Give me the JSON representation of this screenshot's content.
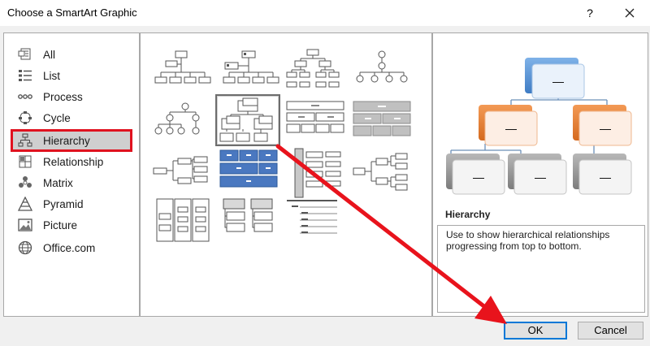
{
  "window": {
    "title": "Choose a SmartArt Graphic",
    "help": "?",
    "close": "×"
  },
  "categories": [
    {
      "id": "all",
      "label": "All",
      "icon": "all-icon"
    },
    {
      "id": "list",
      "label": "List",
      "icon": "list-icon"
    },
    {
      "id": "process",
      "label": "Process",
      "icon": "process-icon"
    },
    {
      "id": "cycle",
      "label": "Cycle",
      "icon": "cycle-icon"
    },
    {
      "id": "hierarchy",
      "label": "Hierarchy",
      "icon": "hierarchy-icon",
      "selected": true
    },
    {
      "id": "relationship",
      "label": "Relationship",
      "icon": "relationship-icon"
    },
    {
      "id": "matrix",
      "label": "Matrix",
      "icon": "matrix-icon"
    },
    {
      "id": "pyramid",
      "label": "Pyramid",
      "icon": "pyramid-icon"
    },
    {
      "id": "picture",
      "label": "Picture",
      "icon": "picture-icon"
    },
    {
      "id": "office",
      "label": "Office.com",
      "icon": "globe-icon"
    }
  ],
  "preview": {
    "title": "Hierarchy",
    "description": "Use to show hierarchical relationships progressing from top to bottom.",
    "placeholder": "—"
  },
  "buttons": {
    "ok": "OK",
    "cancel": "Cancel"
  },
  "colors": {
    "accent": "#0078d7",
    "highlight": "#e0121f",
    "blue_box": "#4a86c8",
    "orange_box": "#e8823a"
  }
}
